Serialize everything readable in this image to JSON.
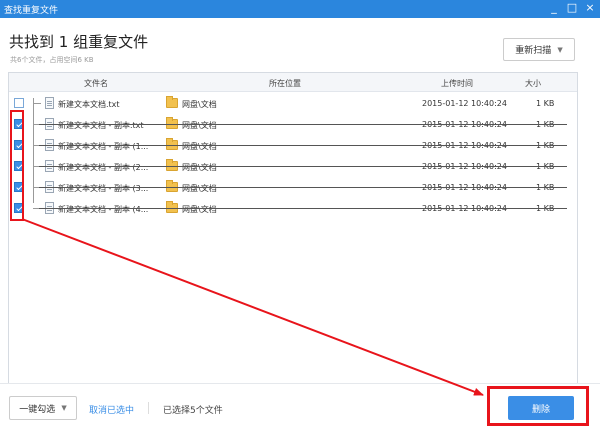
{
  "window": {
    "title": "查找重复文件",
    "controls": [
      "_",
      "□",
      "×"
    ]
  },
  "header": {
    "title": "共找到 1 组重复文件",
    "subtitle": "共6个文件，占用空间6 KB",
    "rescan_label": "重新扫描"
  },
  "table": {
    "columns": [
      "文件名",
      "所在位置",
      "上传时间",
      "大小"
    ],
    "rows": [
      {
        "name": "新建文本文档.txt",
        "location": "网盘\\文档",
        "time": "2015-01-12 10:40:24",
        "size": "1 KB",
        "checked": false
      },
      {
        "name": "新建文本文档 - 副本.txt",
        "location": "网盘\\文档",
        "time": "2015-01-12 10:40:24",
        "size": "1 KB",
        "checked": true
      },
      {
        "name": "新建文本文档 - 副本 (1...",
        "location": "网盘\\文档",
        "time": "2015-01-12 10:40:24",
        "size": "1 KB",
        "checked": true
      },
      {
        "name": "新建文本文档 - 副本 (2...",
        "location": "网盘\\文档",
        "time": "2015-01-12 10:40:24",
        "size": "1 KB",
        "checked": true
      },
      {
        "name": "新建文本文档 - 副本 (3...",
        "location": "网盘\\文档",
        "time": "2015-01-12 10:40:24",
        "size": "1 KB",
        "checked": true
      },
      {
        "name": "新建文本文档 - 副本 (4...",
        "location": "网盘\\文档",
        "time": "2015-01-12 10:40:24",
        "size": "1 KB",
        "checked": true
      }
    ]
  },
  "footer": {
    "select_label": "一键勾选",
    "unselect_label": "取消已选中",
    "status": "已选择5个文件",
    "delete_label": "删除"
  },
  "colors": {
    "accent": "#3a8ee6",
    "titlebar": "#2b86dd",
    "annotation": "#e8141b"
  }
}
